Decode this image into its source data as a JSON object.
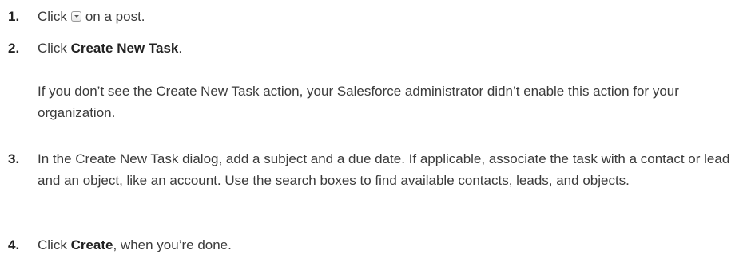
{
  "steps": [
    {
      "number": "1.",
      "before_icon": "Click",
      "icon": "dropdown-arrow-icon",
      "after_icon": "on a post."
    },
    {
      "number": "2.",
      "prefix": "Click ",
      "bold": "Create New Task",
      "suffix": ".",
      "note": "If you don’t see the Create New Task action, your Salesforce administrator didn’t enable this action for your organization."
    },
    {
      "number": "3.",
      "text": "In the Create New Task dialog, add a subject and a due date. If applicable, associate the task with a contact or lead and an object, like an account. Use the search boxes to find available contacts, leads, and objects."
    },
    {
      "number": "4.",
      "prefix": "Click ",
      "bold": "Create",
      "suffix": ", when you’re done."
    }
  ]
}
